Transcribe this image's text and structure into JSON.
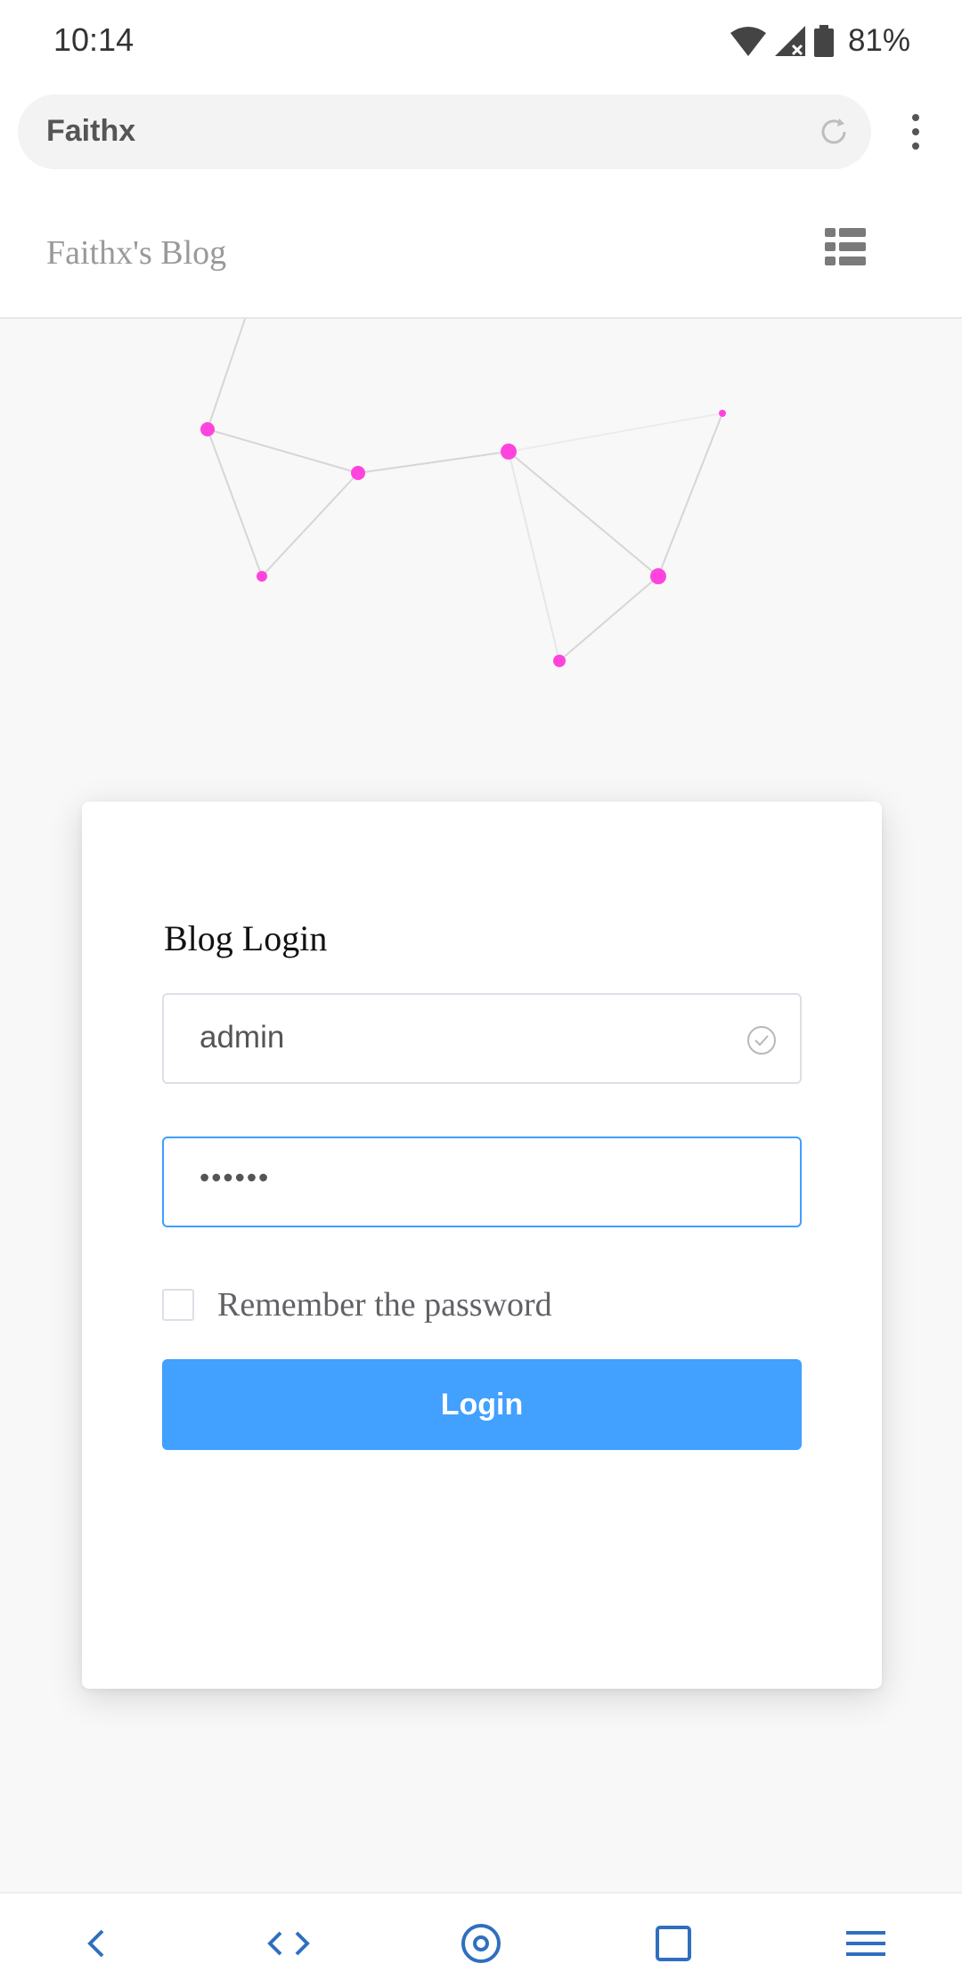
{
  "status_bar": {
    "time": "10:14",
    "battery": "81%",
    "icons": [
      "wifi-icon",
      "cell-signal-icon",
      "battery-icon"
    ]
  },
  "browser": {
    "url_text": "Faithx",
    "icons": [
      "reload-icon",
      "more-options-icon"
    ]
  },
  "site": {
    "title": "Faithx's Blog",
    "menu_icon": "list-menu-icon"
  },
  "login": {
    "title": "Blog Login",
    "username_value": "admin",
    "password_value": "••••••",
    "remember_label": "Remember the password",
    "remember_checked": false,
    "button_label": "Login"
  },
  "bottom_nav": {
    "items": [
      "back-icon",
      "code-icon",
      "home-circle-icon",
      "tabs-square-icon",
      "menu-lines-icon"
    ]
  },
  "colors": {
    "accent": "#42a0ff",
    "focus_border": "#409eff",
    "particle": "#ff44dd",
    "nav_icon": "#2f6fbf"
  }
}
